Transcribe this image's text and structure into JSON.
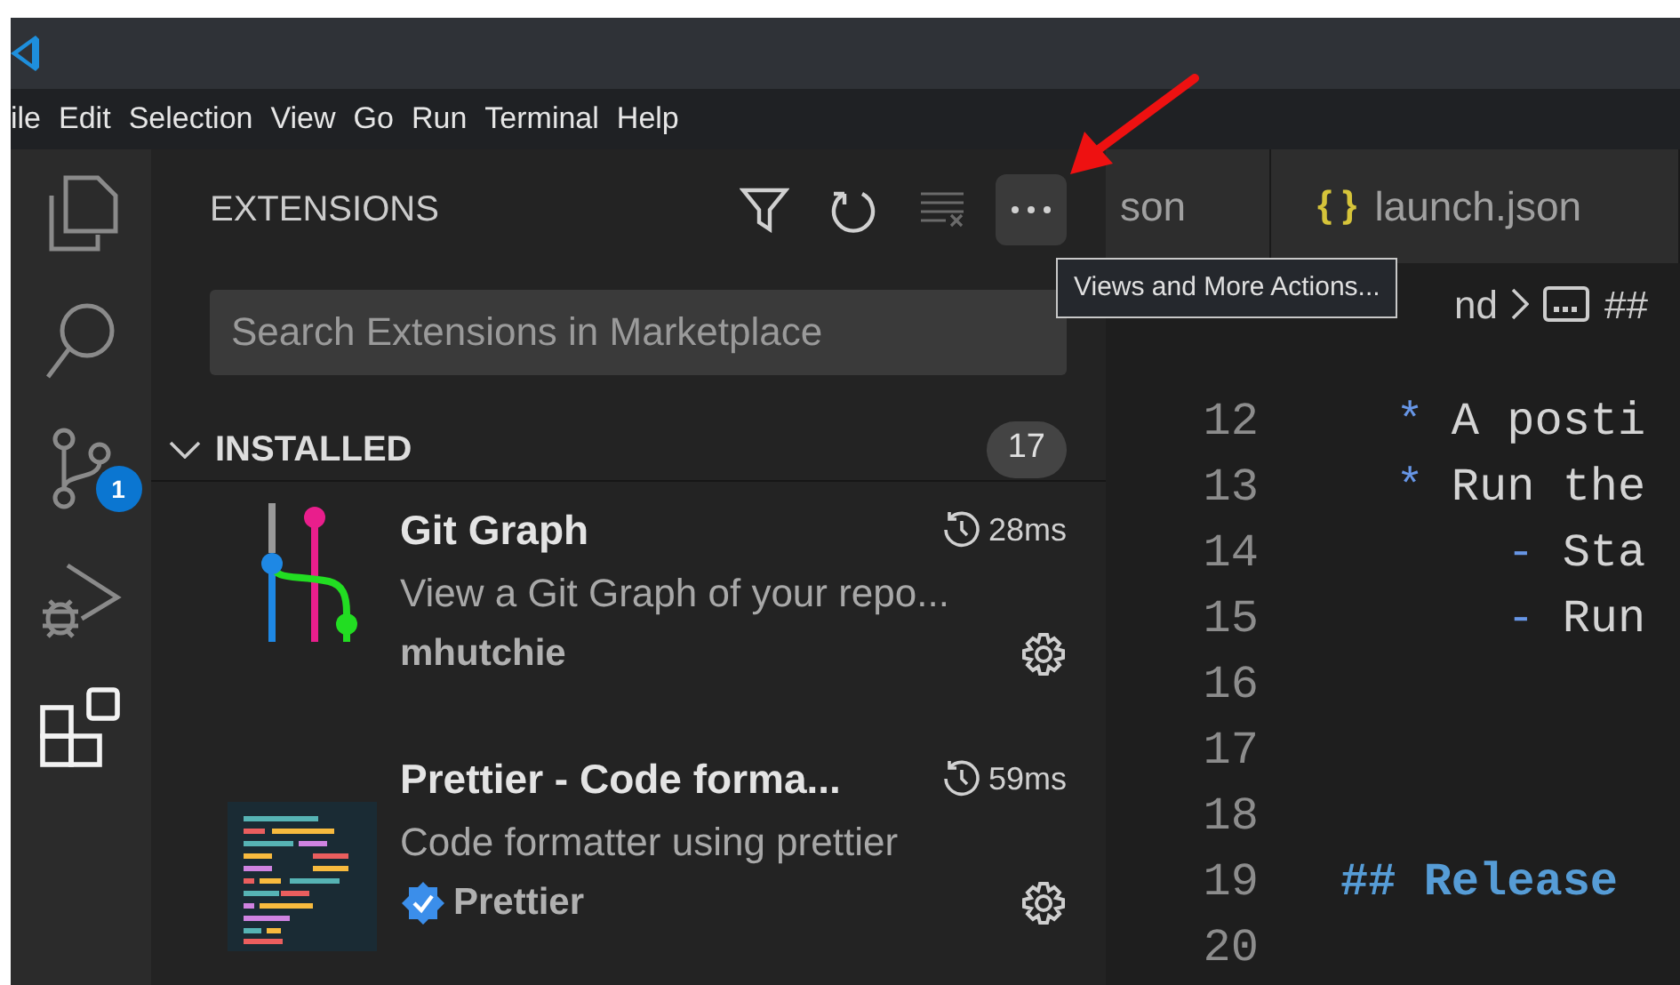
{
  "menu": [
    "ile",
    "Edit",
    "Selection",
    "View",
    "Go",
    "Run",
    "Terminal",
    "Help"
  ],
  "activity_bar": [
    {
      "kind": "files",
      "selected": false
    },
    {
      "kind": "search",
      "selected": false
    },
    {
      "kind": "source-control",
      "selected": false,
      "badge": "1"
    },
    {
      "kind": "run-debug",
      "selected": false
    },
    {
      "kind": "extensions",
      "selected": true
    }
  ],
  "sidebar": {
    "title": "EXTENSIONS",
    "actions": [
      {
        "kind": "filter"
      },
      {
        "kind": "refresh"
      },
      {
        "kind": "clear",
        "disabled": true
      },
      {
        "kind": "more",
        "hovered": true
      }
    ],
    "search": {
      "placeholder": "Search Extensions in Marketplace"
    },
    "section": {
      "title": "INSTALLED",
      "count": "17",
      "expanded": true
    },
    "extensions": [
      {
        "kind": "git-graph",
        "name": "Git Graph",
        "time": "28ms",
        "description": "View a Git Graph of your repo...",
        "publisher": "mhutchie",
        "verified": false
      },
      {
        "kind": "prettier",
        "name": "Prettier - Code forma...",
        "time": "59ms",
        "description": "Code formatter using prettier",
        "publisher": "Prettier",
        "verified": true
      }
    ]
  },
  "tooltip": "Views and More Actions...",
  "editor": {
    "tabs": [
      {
        "label": "son",
        "kind": "plain",
        "selected": false
      },
      {
        "label": "launch.json",
        "kind": "json",
        "icon_text": "{ }",
        "selected": false
      }
    ],
    "breadcrumb": [
      "nd",
      "##"
    ],
    "lines": [
      {
        "number": "12",
        "kind": "list",
        "marker": "  *",
        "text": " A posti"
      },
      {
        "number": "13",
        "kind": "list",
        "marker": "  *",
        "text": " Run the"
      },
      {
        "number": "14",
        "kind": "list",
        "marker": "      -",
        "text": " Sta"
      },
      {
        "number": "15",
        "kind": "list",
        "marker": "      -",
        "text": " Run"
      },
      {
        "number": "16",
        "kind": "blank"
      },
      {
        "number": "17",
        "kind": "blank"
      },
      {
        "number": "18",
        "kind": "blank"
      },
      {
        "number": "19",
        "kind": "heading",
        "marker": "##",
        "text": " Release"
      },
      {
        "number": "20",
        "kind": "blank"
      }
    ]
  }
}
